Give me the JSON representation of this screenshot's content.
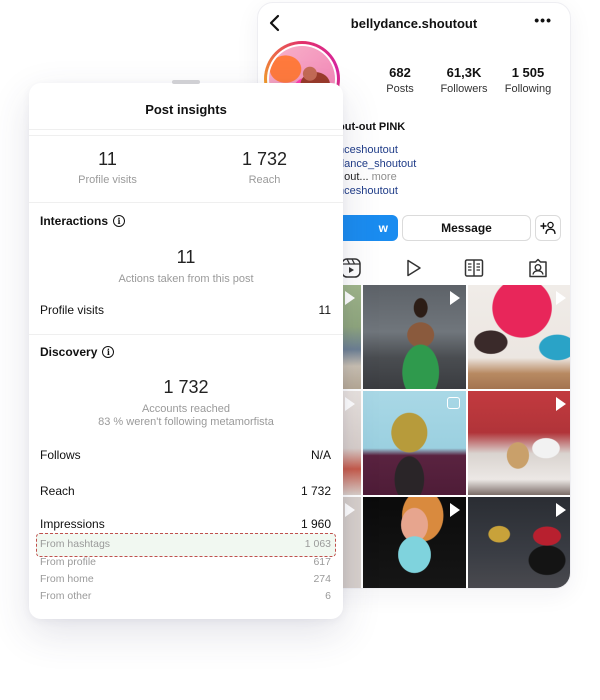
{
  "profile": {
    "username": "bellydance.shoutout",
    "stats": [
      {
        "value": "682",
        "label": "Posts"
      },
      {
        "value": "61,3K",
        "label": "Followers"
      },
      {
        "value": "1 505",
        "label": "Following"
      }
    ],
    "bio": {
      "name_fragment": "out-out PINK",
      "line1": "nceshoutout",
      "line2": "dance_shoutout",
      "line3": "t out...",
      "more_label": "more",
      "line4": "nceshoutout"
    },
    "follow_label": "w",
    "message_label": "Message",
    "tabs": [
      "reels-icon",
      "play-icon",
      "guide-icon",
      "tagged-icon"
    ]
  },
  "insights": {
    "title": "Post insights",
    "top_metrics": [
      {
        "value": "11",
        "label": "Profile visits"
      },
      {
        "value": "1 732",
        "label": "Reach"
      }
    ],
    "interactions": {
      "title": "Interactions",
      "total": "11",
      "total_label": "Actions taken from this post",
      "rows": [
        {
          "label": "Profile visits",
          "value": "11"
        }
      ]
    },
    "discovery": {
      "title": "Discovery",
      "total": "1 732",
      "total_label": "Accounts reached",
      "subtext": "83 % weren't following metamorfista",
      "rows": [
        {
          "label": "Follows",
          "value": "N/A"
        },
        {
          "label": "Reach",
          "value": "1 732"
        },
        {
          "label": "Impressions",
          "value": "1 960"
        }
      ],
      "impression_sources": [
        {
          "label": "From hashtags",
          "value": "1 063",
          "highlighted": true
        },
        {
          "label": "From profile",
          "value": "617"
        },
        {
          "label": "From home",
          "value": "274"
        },
        {
          "label": "From other",
          "value": "6"
        }
      ]
    }
  },
  "colors": {
    "follow_button": "#1a8cf0",
    "highlight_border": "#c0504d",
    "highlight_fill": "#f1f8f1",
    "link": "#1f3c88"
  }
}
